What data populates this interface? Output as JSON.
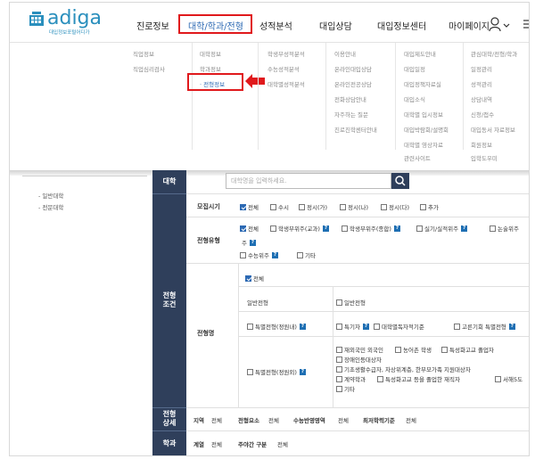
{
  "header": {
    "logo_text": "adiga",
    "logo_sub": "대입정보포털어디가",
    "nav": [
      "진로정보",
      "대학/학과/전형",
      "성적분석",
      "대입상담",
      "대입정보센터",
      "마이페이지"
    ]
  },
  "dropdown": {
    "col1": [
      "직업정보",
      "직업심리검사"
    ],
    "col2": [
      "대학정보",
      "학과정보",
      "· 전형정보"
    ],
    "col3": [
      "학생부성적분석",
      "수능성적분석",
      "대학별성적분석"
    ],
    "col4": [
      "이용안내",
      "온라인대입상담",
      "온라인전공상담",
      "전화상담안내",
      "자주하는 질문",
      "진로진학센터안내"
    ],
    "col5": [
      "대입제도안내",
      "대입일정",
      "대입정책자료실",
      "대입소식",
      "대학별 입시정보",
      "대입박람회/설명회",
      "대학별 영상자료",
      "관련사이트"
    ],
    "col6": [
      "관심대학/전형/학과",
      "일정관리",
      "성적관리",
      "상담내역",
      "신청/접수",
      "대입동서 자료정보",
      "회원정보",
      "입학도우미"
    ]
  },
  "left_nav": [
    "- 일반대학",
    "- 전문대학"
  ],
  "table": {
    "headers": [
      "대학",
      "전형\n조건",
      "전형\n상세",
      "학과"
    ],
    "search_placeholder": "대학명을 입력하세요.",
    "recruit_label": "모집시기",
    "recruit_opts": [
      "전체",
      "수시",
      "정시(가)",
      "정시(나)",
      "정시(다)",
      "추가"
    ],
    "type_label": "전형유형",
    "type_opts_row1": [
      "전체",
      "학생부위주(교과)",
      "학생부위주(종합)",
      "실기/실적위주",
      "논술위주"
    ],
    "type_opts_row2": [
      "수능위주",
      "기타"
    ],
    "name_label": "전형명",
    "all_label": "전체",
    "general_left": "일반전형",
    "general_right": "일반전형",
    "special_left": "특별전형(정원내)",
    "special_right": [
      "특기자",
      "대학별독자적기준",
      "고른기회 특별전형"
    ],
    "outside_left": "특별전형(정원외)",
    "outside_right": [
      "재외국민 외국인",
      "농어촌 학생",
      "특성화고교 졸업자",
      "장애인등대상자",
      "기초생활수급자, 차상위계층, 한부모가족 지원대상자",
      "계약학과",
      "특성화고교 등을 졸업한 재직자",
      "서해5도",
      "기타"
    ],
    "detail": [
      {
        "key": "지역",
        "val": "전체"
      },
      {
        "key": "전형요소",
        "val": "전체"
      },
      {
        "key": "수능반영영역",
        "val": "전체"
      },
      {
        "key": "최저학력기준",
        "val": "전체"
      }
    ],
    "dept": [
      {
        "key": "계열",
        "val": "전체"
      },
      {
        "key": "주야간 구분",
        "val": "전체"
      }
    ]
  }
}
